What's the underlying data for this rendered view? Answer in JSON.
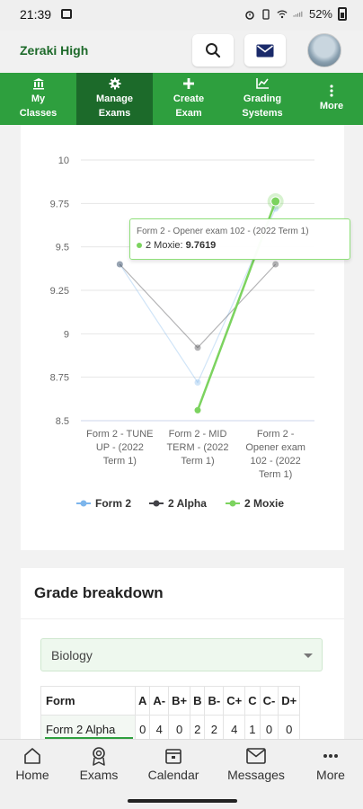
{
  "status_bar": {
    "time": "21:39",
    "battery": "52%"
  },
  "header": {
    "school_name": "Zeraki High"
  },
  "nav_tabs": [
    {
      "icon": "bank-icon",
      "label_line1": "My",
      "label_line2": "Classes",
      "active": false
    },
    {
      "icon": "gear-icon",
      "label_line1": "Manage",
      "label_line2": "Exams",
      "active": true
    },
    {
      "icon": "plus-icon",
      "label_line1": "Create",
      "label_line2": "Exam",
      "active": false
    },
    {
      "icon": "chart-line-icon",
      "label_line1": "Grading",
      "label_line2": "Systems",
      "active": false
    },
    {
      "icon": "more-vertical-icon",
      "label_line1": "More",
      "label_line2": "",
      "active": false
    }
  ],
  "chart_data": {
    "type": "line",
    "categories": [
      [
        "Form 2 - TUNE",
        "UP - (2022",
        "Term 1)"
      ],
      [
        "Form 2 - MID",
        "TERM - (2022",
        "Term 1)"
      ],
      [
        "Form 2 -",
        "Opener exam",
        "102 - (2022",
        "Term 1)"
      ]
    ],
    "y_ticks": [
      "10",
      "9.75",
      "9.5",
      "9.25",
      "9",
      "8.75",
      "8.5"
    ],
    "ylim": [
      8.5,
      10
    ],
    "series": [
      {
        "name": "Form 2",
        "color": "#7cb5ec",
        "values": [
          9.4,
          8.72,
          9.72
        ]
      },
      {
        "name": "2 Alpha",
        "color": "#434348",
        "values": [
          9.4,
          8.92,
          9.4
        ]
      },
      {
        "name": "2 Moxie",
        "color": "#7cd35f",
        "values": [
          null,
          8.56,
          9.7619
        ]
      }
    ],
    "tooltip": {
      "title": "Form 2 - Opener exam 102 - (2022 Term 1)",
      "series_name": "2 Moxie",
      "value": "9.7619"
    }
  },
  "grade_breakdown": {
    "title": "Grade breakdown",
    "selected_subject": "Biology",
    "columns": [
      "Form",
      "A",
      "A-",
      "B+",
      "B",
      "B-",
      "C+",
      "C",
      "C-",
      "D+"
    ],
    "rows": [
      {
        "form": "Form 2 Alpha",
        "values": [
          "0",
          "4",
          "0",
          "2",
          "2",
          "4",
          "1",
          "0",
          "0"
        ]
      }
    ]
  },
  "bottom_nav": [
    {
      "icon": "home-icon",
      "label": "Home"
    },
    {
      "icon": "exams-badge-icon",
      "label": "Exams"
    },
    {
      "icon": "calendar-icon",
      "label": "Calendar"
    },
    {
      "icon": "messages-icon",
      "label": "Messages"
    },
    {
      "icon": "more-horizontal-icon",
      "label": "More"
    }
  ]
}
